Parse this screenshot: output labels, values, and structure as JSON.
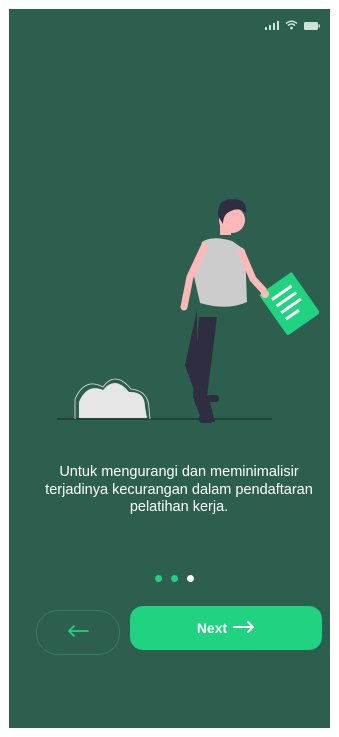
{
  "colors": {
    "background": "#2c5f4e",
    "accent": "#1fd381",
    "dot_inactive": "#1fd381",
    "dot_active": "#ffffff"
  },
  "status_bar": {
    "icons": [
      "signal-icon",
      "wifi-icon",
      "battery-icon"
    ]
  },
  "onboarding": {
    "caption": "Untuk mengurangi dan meminimalisir terjadinya kecurangan dalam pendaftaran pelatihan kerja.",
    "page_indicator": {
      "total": 3,
      "active": 3
    }
  },
  "navigation": {
    "back_icon": "arrow-left-icon",
    "next_label": "Next",
    "next_icon": "arrow-right-icon"
  }
}
